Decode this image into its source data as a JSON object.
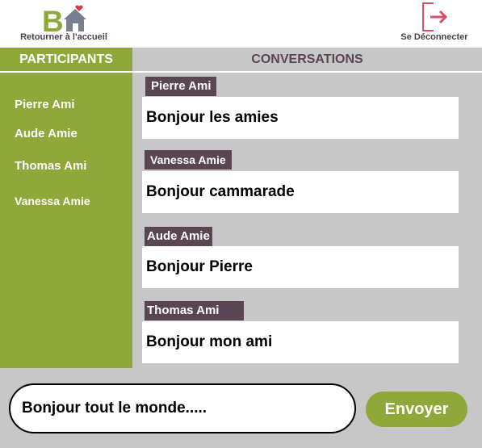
{
  "header": {
    "home_label": "Retourner à l'accueil",
    "home_icon": "home-logo-icon",
    "logout_label": "Se Déconnecter",
    "logout_icon": "logout-icon"
  },
  "sidebar": {
    "title": "PARTICIPANTS",
    "participants": [
      "Pierre Ami",
      "Aude Amie",
      "Thomas Ami",
      "Vanessa Amie"
    ]
  },
  "conversations": {
    "title": "CONVERSATIONS",
    "messages": [
      {
        "author": "Pierre Ami",
        "text": "Bonjour les amies"
      },
      {
        "author": "Vanessa Amie",
        "text": "Bonjour cammarade"
      },
      {
        "author": "Aude Amie",
        "text": "Bonjour Pierre"
      },
      {
        "author": "Thomas Ami",
        "text": "Bonjour mon ami"
      }
    ]
  },
  "composer": {
    "input_value": "Bonjour tout le monde.....",
    "send_label": "Envoyer"
  },
  "colors": {
    "accent_green": "#8fa83a",
    "author_purple": "#5a4553",
    "panel_gray": "#c7c7c7",
    "logo_red": "#e0304a",
    "logout_pink": "#d6506a"
  }
}
